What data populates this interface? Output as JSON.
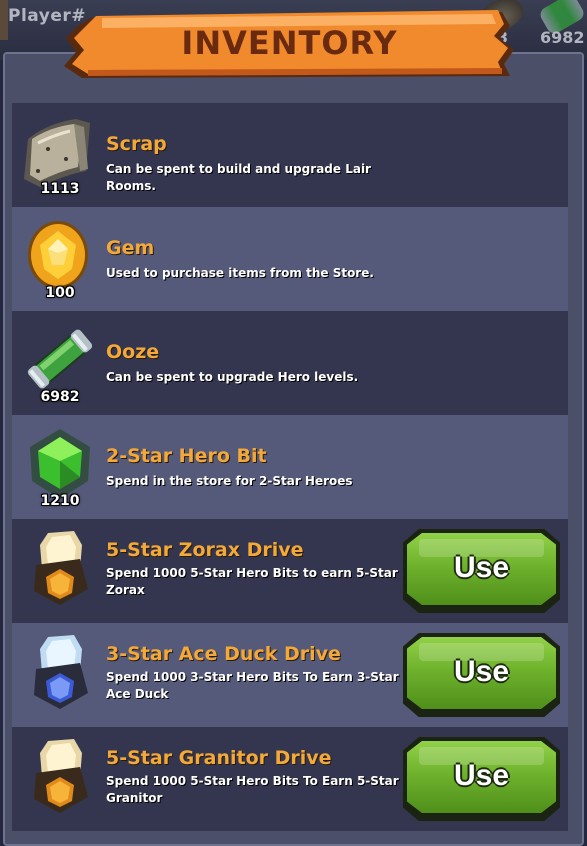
{
  "hud": {
    "player_label": "Player#",
    "resource_a_value": "3",
    "resource_b_value": "6982"
  },
  "header": {
    "title": "INVENTORY"
  },
  "items": [
    {
      "name": "Scrap",
      "desc": "Can be spent to build and upgrade Lair Rooms.",
      "count": "1113",
      "icon": "scrap-icon"
    },
    {
      "name": "Gem",
      "desc": "Used to purchase items from the Store.",
      "count": "100",
      "icon": "gem-icon"
    },
    {
      "name": "Ooze",
      "desc": "Can be spent to upgrade Hero levels.",
      "count": "6982",
      "icon": "ooze-icon"
    },
    {
      "name": "2-Star Hero Bit",
      "desc": "Spend in the store for 2-Star Heroes",
      "count": "1210",
      "icon": "hero-bit-icon"
    },
    {
      "name": "5-Star Zorax Drive",
      "desc": "Spend 1000 5-Star Hero Bits to earn 5-Star Zorax",
      "use_label": "Use",
      "icon": "zorax-drive-icon"
    },
    {
      "name": "3-Star Ace Duck Drive",
      "desc": "Spend 1000 3-Star Hero Bits To Earn 3-Star Ace Duck",
      "use_label": "Use",
      "icon": "ace-duck-drive-icon"
    },
    {
      "name": "5-Star Granitor Drive",
      "desc": "Spend 1000 5-Star Hero Bits To Earn 5-Star Granitor",
      "use_label": "Use",
      "icon": "granitor-drive-icon"
    }
  ],
  "colors": {
    "item_name": "#f3a93a",
    "row_dark": "#34364f",
    "row_light": "#55597a",
    "button_green": "#6fb22c",
    "banner_orange": "#f08a2c"
  }
}
